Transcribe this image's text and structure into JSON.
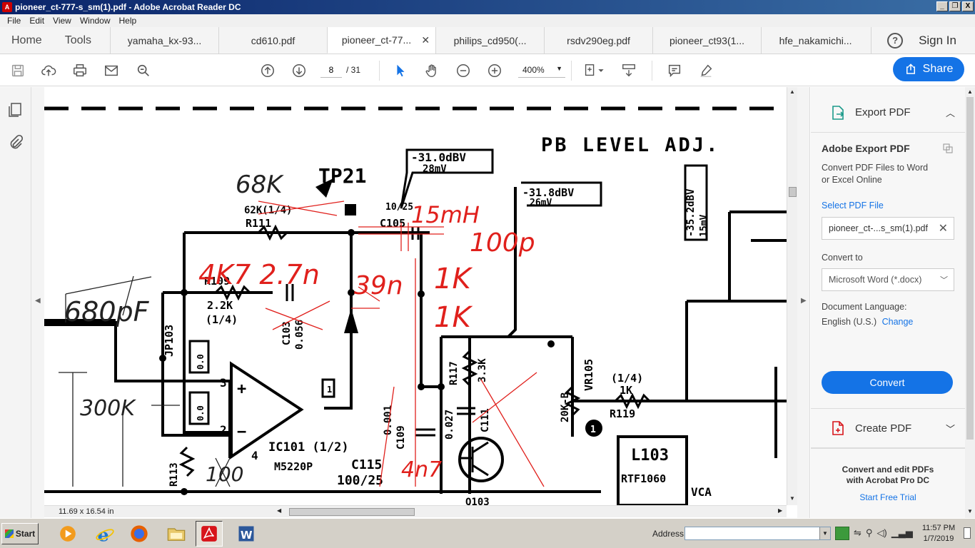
{
  "window": {
    "title": "pioneer_ct-777-s_sm(1).pdf - Adobe Acrobat Reader DC",
    "app_icon": "acrobat-icon",
    "controls": [
      "_",
      "❐",
      "X"
    ]
  },
  "menu": [
    "File",
    "Edit",
    "View",
    "Window",
    "Help"
  ],
  "nav": {
    "home": "Home",
    "tools": "Tools",
    "help_icon": "?",
    "signin": "Sign In"
  },
  "tabs": [
    {
      "label": "yamaha_kx-93...",
      "active": false
    },
    {
      "label": "cd610.pdf",
      "active": false
    },
    {
      "label": "pioneer_ct-77...",
      "active": true
    },
    {
      "label": "philips_cd950(...",
      "active": false
    },
    {
      "label": "rsdv290eg.pdf",
      "active": false
    },
    {
      "label": "pioneer_ct93(1...",
      "active": false
    },
    {
      "label": "hfe_nakamichi...",
      "active": false
    }
  ],
  "tab_close": "✕",
  "toolbar": {
    "page_current": "8",
    "page_total": "/ 31",
    "zoom": "400%",
    "share": "Share"
  },
  "document": {
    "dimensions": "11.69 x 16.54 in",
    "schematic_labels": {
      "pb_level": "PB LEVEL ADJ.",
      "tp21": "TP21",
      "db1": "-31.0dBV",
      "mv1": "28mV",
      "db2": "-31.8dBV",
      "mv2": "26mV",
      "db3": "-35.2dBV",
      "mv3": "15mV",
      "r111_val": "62K(1/4)",
      "r111": "R111",
      "r109": "R109",
      "r109_val": "2.2K",
      "r109_w": "(1/4)",
      "c105": "C105",
      "c105_val": "10/25",
      "c103": "C103",
      "c103_val": "0.056",
      "jp103": "JP103",
      "ic101": "IC101 (1/2)",
      "m5220p": "M5220P",
      "c115": "C115",
      "c115_val": "100/25",
      "r113": "R113",
      "r117": "R117",
      "r117_val": "3.3K",
      "c111": "C111",
      "c111_val": "0.027",
      "c109": "C109",
      "c109_val": "0.001",
      "vr105": "VR105",
      "vr_val": "20K-B",
      "r119": "R119",
      "r119_w": "(1/4)",
      "r119_val": "1K",
      "l103": "L103",
      "rtf": "RTF1060",
      "vca": "VCA",
      "q103": "Q103",
      "pin1": "1",
      "pin2": "2",
      "pin3": "3",
      "pin4": "4",
      "circ1": "1",
      "box1": "0.0",
      "box2": "0.0",
      "plus": "+",
      "minus": "−"
    },
    "handwritten": {
      "k68": "68K",
      "pf680": "680pF",
      "k300": "300K",
      "hw100": "100",
      "red_4k7": "4K7 2.7n",
      "red_39n": "39n",
      "red_1k_a": "1K",
      "red_1k_b": "1K",
      "red_100p": "100p",
      "red_15mh": "15mH",
      "red_4n7": "4n7"
    }
  },
  "right_pane": {
    "export_header": "Export PDF",
    "adobe_export": "Adobe Export PDF",
    "desc_line1": "Convert PDF Files to Word",
    "desc_line2": "or Excel Online",
    "select_file": "Select PDF File",
    "file_name": "pioneer_ct-...s_sm(1).pdf",
    "convert_to": "Convert to",
    "format": "Microsoft Word (*.docx)",
    "doc_lang_label": "Document Language:",
    "doc_lang": "English (U.S.)",
    "change": "Change",
    "convert": "Convert",
    "create_header": "Create PDF",
    "promo_line1": "Convert and edit PDFs",
    "promo_line2": "with Acrobat Pro DC",
    "trial": "Start Free Trial"
  },
  "taskbar": {
    "start": "Start",
    "address_label": "Address",
    "time": "11:57 PM",
    "date": "1/7/2019"
  },
  "colors": {
    "accent": "#1473e6",
    "titlebar": "#0a246a",
    "red_ink": "#e0201c",
    "acrobat_red": "#d7141a"
  }
}
